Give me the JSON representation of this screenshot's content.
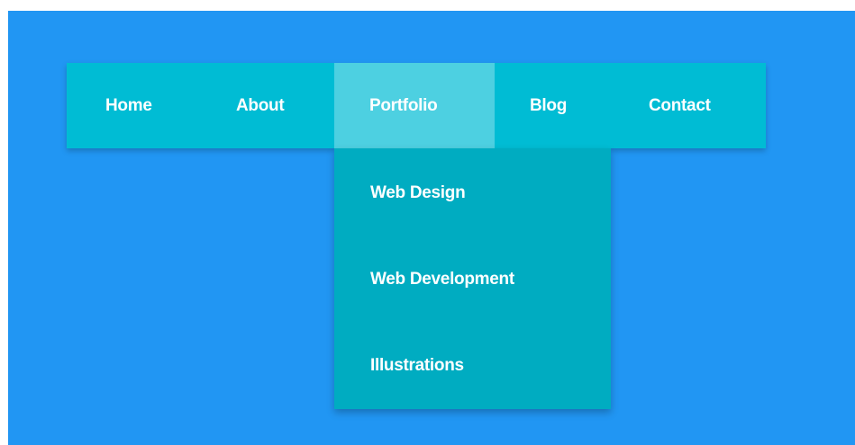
{
  "colors": {
    "page_background": "#2196f3",
    "navbar_background": "#00bcd4",
    "navbar_active_background": "#4dd0e1",
    "dropdown_background": "#00acc1",
    "text": "#ffffff"
  },
  "nav": {
    "items": [
      {
        "label": "Home"
      },
      {
        "label": "About"
      },
      {
        "label": "Portfolio",
        "active": true
      },
      {
        "label": "Blog"
      },
      {
        "label": "Contact"
      }
    ]
  },
  "dropdown": {
    "parent": "Portfolio",
    "items": [
      {
        "label": "Web Design"
      },
      {
        "label": "Web Development"
      },
      {
        "label": "Illustrations"
      }
    ]
  }
}
